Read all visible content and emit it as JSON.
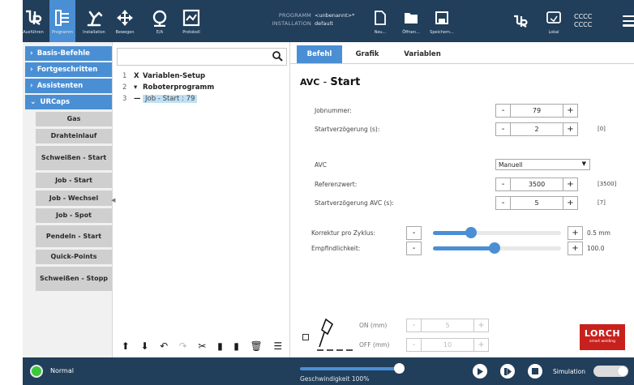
{
  "topbar": {
    "buttons": [
      {
        "label": "Ausführen",
        "icon": "ur-logo-icon"
      },
      {
        "label": "Programm",
        "icon": "program-icon"
      },
      {
        "label": "Installation",
        "icon": "installation-icon"
      },
      {
        "label": "Bewegen",
        "icon": "move-icon"
      },
      {
        "label": "E/A",
        "icon": "io-icon"
      },
      {
        "label": "Protokoll",
        "icon": "log-icon"
      }
    ],
    "program_key": "PROGRAMM",
    "program_value": "<unbenannt>*",
    "installation_key": "INSTALLATION",
    "installation_value": "default",
    "file_buttons": [
      {
        "label": "Neu...",
        "icon": "new-file-icon"
      },
      {
        "label": "Öffnen...",
        "icon": "open-folder-icon"
      },
      {
        "label": "Speichern...",
        "icon": "save-icon"
      }
    ],
    "ur_button_icon": "ur-logo-icon",
    "local_label": "Lokal",
    "cccc_1": "CCCC",
    "cccc_2": "CCCC",
    "menu_icon": "hamburger-menu-icon"
  },
  "leftnav": {
    "categories": [
      {
        "label": "Basis-Befehle",
        "chevron": "›"
      },
      {
        "label": "Fortgeschritten",
        "chevron": "›"
      },
      {
        "label": "Assistenten",
        "chevron": "›"
      },
      {
        "label": "URCaps",
        "chevron": "⌄"
      }
    ],
    "urcaps": [
      "Gas",
      "Drahteinlauf",
      "Schweißen - Start",
      "Job - Start",
      "Job - Wechsel",
      "Job - Spot",
      "Pendeln - Start",
      "Quick-Points",
      "Schweißen - Stopp"
    ]
  },
  "tree": {
    "search_placeholder": "",
    "rows": [
      {
        "num": "1",
        "mark": "X",
        "text": "Variablen-Setup"
      },
      {
        "num": "2",
        "mark": "▾",
        "text": "Roboterprogramm"
      },
      {
        "num": "3",
        "mark": "—",
        "text": "Job - Start : 79"
      }
    ],
    "toolbar": [
      {
        "glyph": "⬆",
        "icon": "move-up-icon"
      },
      {
        "glyph": "⬇",
        "icon": "move-down-icon"
      },
      {
        "glyph": "↶",
        "icon": "undo-icon"
      },
      {
        "glyph": "↷",
        "icon": "redo-icon"
      },
      {
        "glyph": "✂",
        "icon": "cut-icon"
      },
      {
        "glyph": "▮",
        "icon": "copy-icon"
      },
      {
        "glyph": "▮",
        "icon": "paste-icon"
      },
      {
        "glyph": "🗑",
        "icon": "delete-icon"
      },
      {
        "glyph": "☰",
        "icon": "suppress-icon"
      }
    ]
  },
  "main": {
    "tabs": [
      "Befehl",
      "Grafik",
      "Variablen"
    ],
    "title_prefix": "AVC",
    "title_suffix": "Start",
    "title_sep": "-",
    "fields": [
      {
        "label": "Jobnummer:",
        "value": "79",
        "extra": ""
      },
      {
        "label": "Startverzögerung (s):",
        "value": "2",
        "extra": "[0]"
      }
    ],
    "avc_label": "AVC",
    "avc_value": "Manuell",
    "avc_fields": [
      {
        "label": "Referenzwert:",
        "value": "3500",
        "extra": "[3500]"
      },
      {
        "label": "Startverzögerung AVC (s):",
        "value": "5",
        "extra": "[7]"
      }
    ],
    "sliders": [
      {
        "label": "Korrektur pro Zyklus:",
        "value": "0.5 mm",
        "level_percent": 30
      },
      {
        "label": "Empfindlichkeit:",
        "value": "100.0",
        "level_percent": 48
      }
    ],
    "on_label": "ON (mm)",
    "on_value": "5",
    "off_label": "OFF (mm)",
    "off_value": "10",
    "lorch_name": "LORCH",
    "lorch_sub": "smart welding"
  },
  "footer": {
    "status": "Normal",
    "speed_label": "Geschwindigkeit 100%",
    "speed_percent": 100,
    "simulation_label": "Simulation",
    "colors": {
      "status": "#3cc83c",
      "accent": "#4a8fd4",
      "bar": "#213e5a"
    }
  }
}
